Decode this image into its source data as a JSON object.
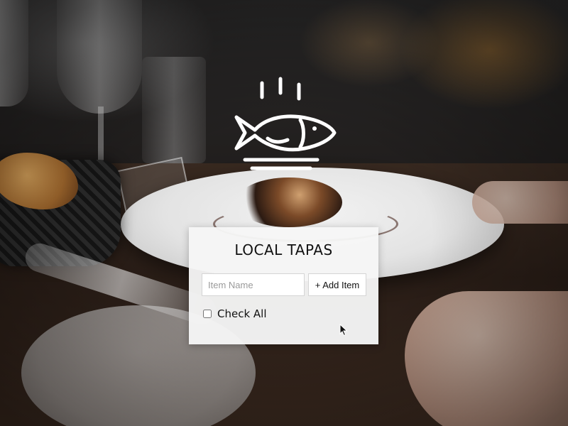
{
  "app": {
    "title": "LOCAL TAPAS"
  },
  "logo": {
    "icon": "fish-on-plate-steaming-icon",
    "color": "#ffffff"
  },
  "form": {
    "item_placeholder": "Item Name",
    "item_value": "",
    "add_button_label": "+ Add Item",
    "check_all_label": "Check All",
    "check_all_checked": false
  },
  "colors": {
    "panel_background": "#f6f6f6",
    "text": "#111111",
    "input_border": "#d5d5d5"
  }
}
